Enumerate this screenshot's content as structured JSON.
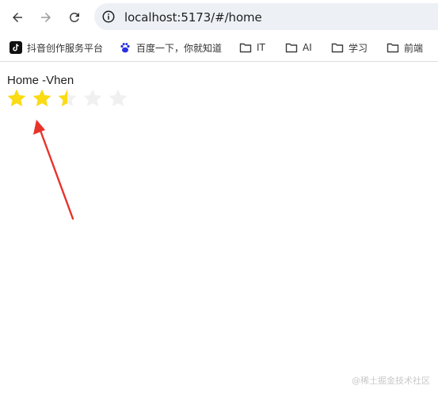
{
  "browser": {
    "url": "localhost:5173/#/home",
    "back_icon": "arrow-left-icon",
    "forward_icon": "arrow-right-icon",
    "reload_icon": "reload-icon",
    "info_icon": "info-icon"
  },
  "bookmarks": [
    {
      "label": "抖音创作服务平台",
      "icon": "tiktok-icon"
    },
    {
      "label": "百度一下，你就知道",
      "icon": "baidu-paw-icon"
    },
    {
      "label": "IT",
      "icon": "folder-icon"
    },
    {
      "label": "AI",
      "icon": "folder-icon"
    },
    {
      "label": "学习",
      "icon": "folder-icon"
    },
    {
      "label": "前端",
      "icon": "folder-icon"
    }
  ],
  "page": {
    "title": "Home -Vhen",
    "rating": {
      "value": 2.5,
      "max": 5
    },
    "colors": {
      "star_filled": "#fadb14",
      "star_empty": "#f0f0f0",
      "arrow": "#e8332a"
    }
  },
  "watermark": "@稀土掘金技术社区"
}
